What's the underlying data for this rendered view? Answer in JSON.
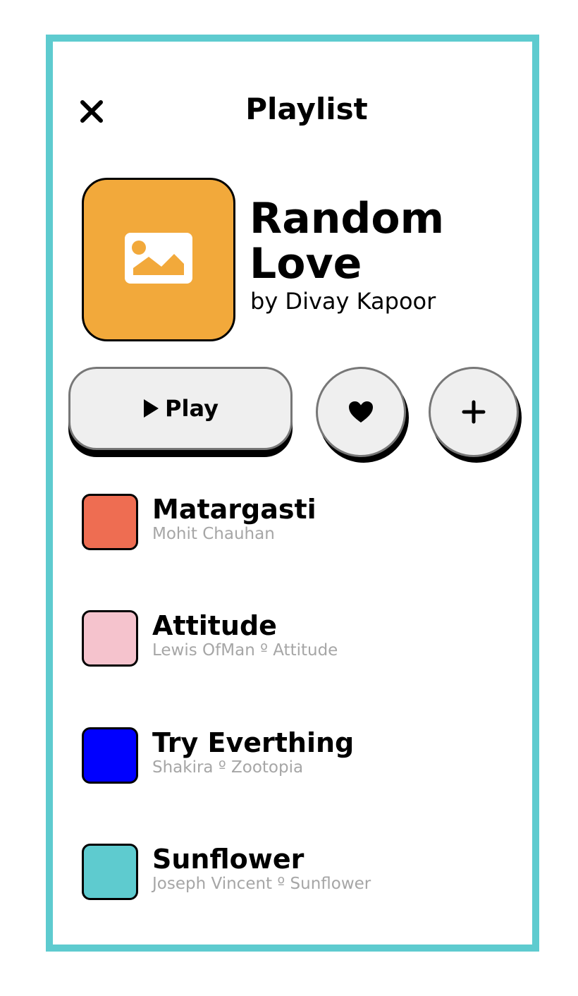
{
  "header": {
    "title": "Playlist",
    "close_icon": "close-icon"
  },
  "playlist": {
    "name_line1": "Random",
    "name_line2": "Love",
    "author": "by Divay Kapoor",
    "cover_icon": "image-icon",
    "cover_color": "#f2a93b"
  },
  "actions": {
    "play_label": "Play",
    "play_icon": "play-icon",
    "like_icon": "heart-icon",
    "add_icon": "plus-icon"
  },
  "songs": [
    {
      "title": "Matargasti",
      "subtitle": "Mohit Chauhan",
      "color": "#ee6d52"
    },
    {
      "title": "Attitude",
      "subtitle": "Lewis OfMan º Attitude",
      "color": "#f5c3cd"
    },
    {
      "title": "Try Everthing",
      "subtitle": "Shakira º Zootopia",
      "color": "#0000ff"
    },
    {
      "title": "Sunflower",
      "subtitle": "Joseph Vincent º Sunflower",
      "color": "#5ecbcf"
    }
  ],
  "theme": {
    "frame_color": "#5ecbcf",
    "button_bg": "#efefef"
  }
}
